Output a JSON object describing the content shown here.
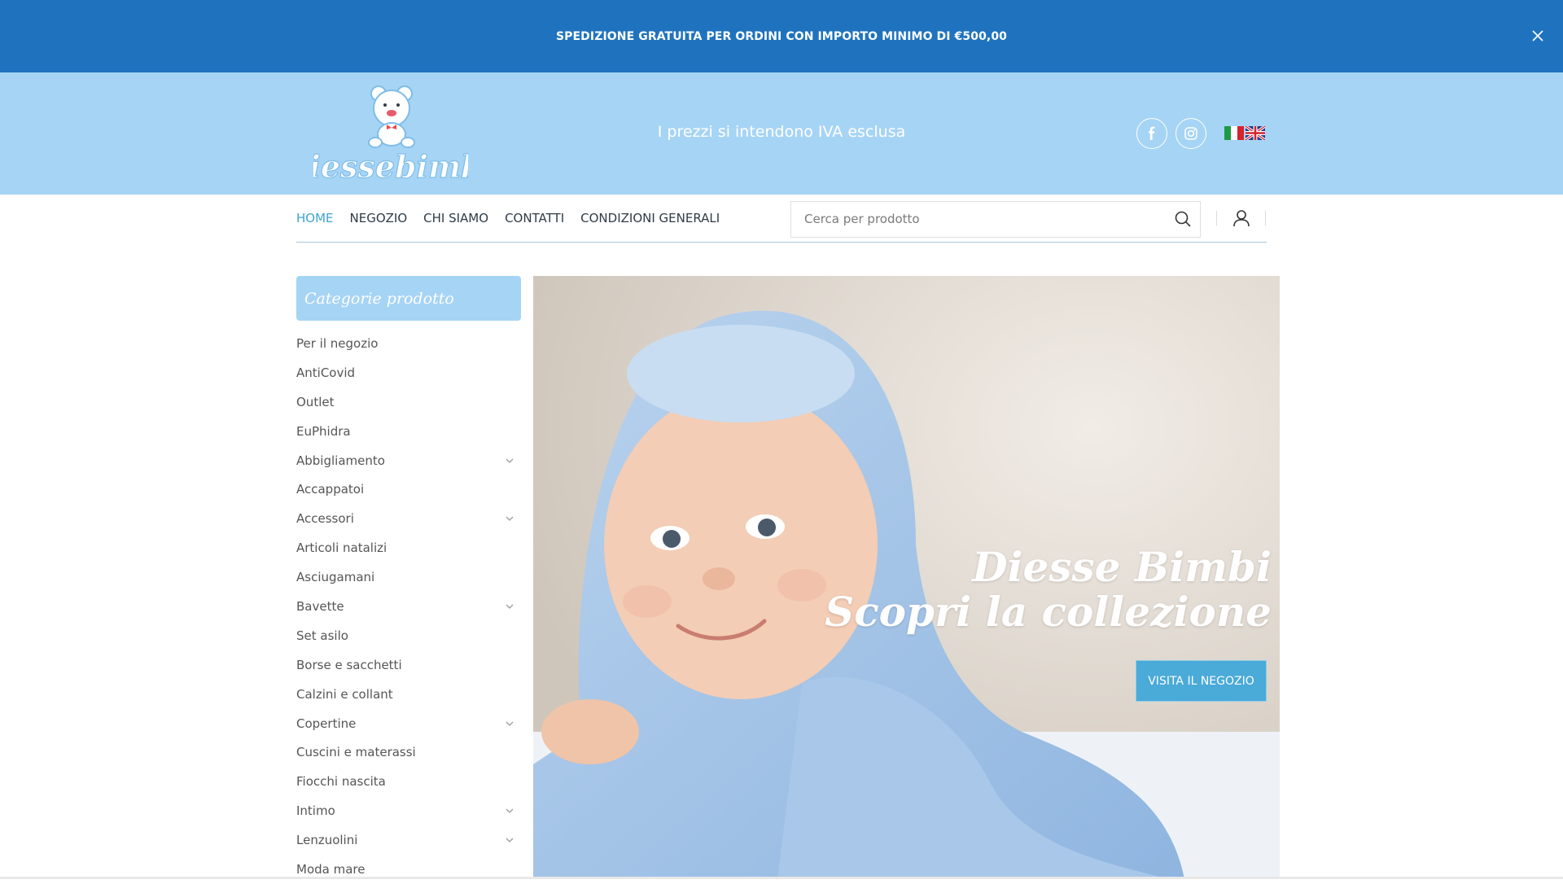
{
  "promo": {
    "text": "SPEDIZIONE GRATUITA PER ORDINI CON IMPORTO MINIMO DI €500,00",
    "close_icon": "close-icon"
  },
  "header": {
    "logo_text": "diessebimbi",
    "tagline": "I prezzi si intendono IVA esclusa",
    "social": [
      {
        "name": "facebook",
        "icon": "facebook-icon"
      },
      {
        "name": "instagram",
        "icon": "instagram-icon"
      }
    ],
    "languages": [
      "it",
      "en"
    ],
    "color": "#a6d4f5"
  },
  "nav": {
    "links": [
      {
        "label": "HOME",
        "active": true
      },
      {
        "label": "NEGOZIO",
        "active": false
      },
      {
        "label": "CHI SIAMO",
        "active": false
      },
      {
        "label": "CONTATTI",
        "active": false
      },
      {
        "label": "CONDIZIONI GENERALI",
        "active": false
      }
    ],
    "active_color": "#3fa4d4",
    "search": {
      "placeholder": "Cerca per prodotto",
      "value": "",
      "icon": "search-icon"
    },
    "user_icon": "user-icon"
  },
  "sidebar": {
    "title": "Categorie prodotto",
    "items": [
      {
        "label": "Per il negozio",
        "has_children": false
      },
      {
        "label": "AntiCovid",
        "has_children": false
      },
      {
        "label": "Outlet",
        "has_children": false
      },
      {
        "label": "EuPhidra",
        "has_children": false
      },
      {
        "label": "Abbigliamento",
        "has_children": true
      },
      {
        "label": "Accappatoi",
        "has_children": false
      },
      {
        "label": "Accessori",
        "has_children": true
      },
      {
        "label": "Articoli natalizi",
        "has_children": false
      },
      {
        "label": "Asciugamani",
        "has_children": false
      },
      {
        "label": "Bavette",
        "has_children": true
      },
      {
        "label": "Set asilo",
        "has_children": false
      },
      {
        "label": "Borse e sacchetti",
        "has_children": false
      },
      {
        "label": "Calzini e collant",
        "has_children": false
      },
      {
        "label": "Copertine",
        "has_children": true
      },
      {
        "label": "Cuscini e materassi",
        "has_children": false
      },
      {
        "label": "Fiocchi nascita",
        "has_children": false
      },
      {
        "label": "Intimo",
        "has_children": true
      },
      {
        "label": "Lenzuolini",
        "has_children": true
      },
      {
        "label": "Moda mare",
        "has_children": false
      }
    ]
  },
  "hero": {
    "line1": "Diesse Bimbi",
    "line2": "Scopri la collezione",
    "button": "VISITA IL NEGOZIO",
    "button_color": "#4aaad8"
  },
  "colors": {
    "promo_bg": "#1f73be",
    "header_bg": "#a6d4f5"
  }
}
